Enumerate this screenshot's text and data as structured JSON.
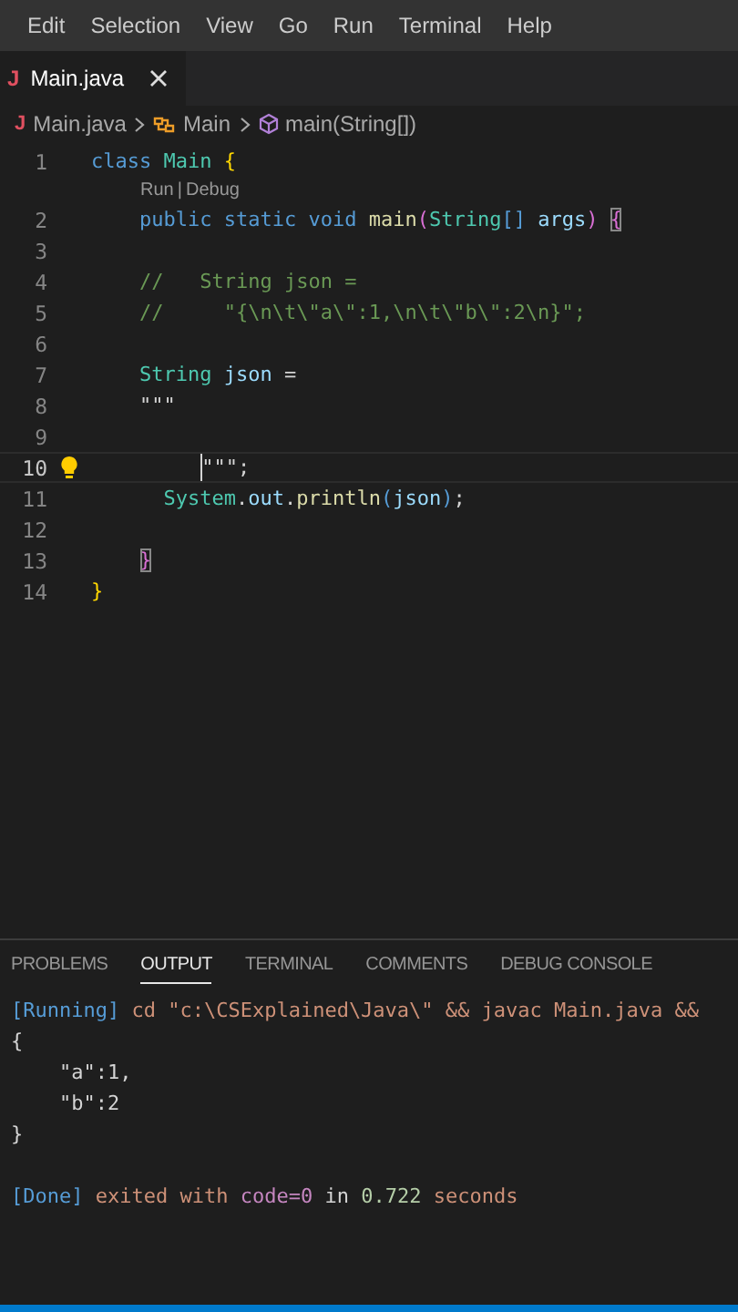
{
  "menu": [
    "Edit",
    "Selection",
    "View",
    "Go",
    "Run",
    "Terminal",
    "Help"
  ],
  "tabs": [
    {
      "label": "Main.java",
      "icon_text": "J",
      "selected": true,
      "closable": true
    }
  ],
  "breadcrumbs": [
    {
      "label": "Main.java",
      "kind": "file",
      "icon_text": "J"
    },
    {
      "label": "Main",
      "kind": "class"
    },
    {
      "label": "main(String[])",
      "kind": "method"
    }
  ],
  "editor": {
    "lines": [
      {
        "number": "1",
        "tokens": [
          {
            "text": "class ",
            "kind": "keyword"
          },
          {
            "text": "Main ",
            "kind": "type"
          },
          {
            "text": "{",
            "kind": "brace"
          }
        ],
        "codelens": {
          "items": [
            "Run",
            "Debug"
          ],
          "separator": "|"
        }
      },
      {
        "number": "2",
        "tokens": [
          {
            "text": "    public static void ",
            "kind": "keyword"
          },
          {
            "text": "main",
            "kind": "func"
          },
          {
            "text": "(",
            "kind": "paren"
          },
          {
            "text": "String",
            "kind": "type"
          },
          {
            "text": "[] ",
            "kind": "keyword"
          },
          {
            "text": "args",
            "kind": "var"
          },
          {
            "text": ") ",
            "kind": "paren"
          },
          {
            "text": "{",
            "kind": "matched"
          }
        ]
      },
      {
        "number": "3"
      },
      {
        "number": "4",
        "tokens": [
          {
            "text": "    //   String json =",
            "kind": "comment"
          }
        ]
      },
      {
        "number": "5",
        "tokens": [
          {
            "text": "    //     \"{\\n\\t\\\"a\\\":1,\\n\\t\\\"b\\\":2\\n}\";",
            "kind": "comment"
          }
        ]
      },
      {
        "number": "6"
      },
      {
        "number": "7",
        "tokens": [
          {
            "text": "    String ",
            "kind": "type"
          },
          {
            "text": "json ",
            "kind": "var"
          },
          {
            "text": "=",
            "kind": "plain"
          }
        ]
      },
      {
        "number": "8",
        "tokens": [
          {
            "text": "    \"\"\"",
            "kind": "plain"
          }
        ]
      },
      {
        "number": "9"
      },
      {
        "number": "10",
        "tokens": [
          {
            "text": "         \"\"\"",
            "kind": "plain"
          },
          {
            "text": ";",
            "kind": "plain"
          }
        ],
        "current": true,
        "lightbulb": true
      },
      {
        "number": "11",
        "tokens": [
          {
            "text": "      System",
            "kind": "type"
          },
          {
            "text": ".",
            "kind": "plain"
          },
          {
            "text": "out",
            "kind": "var"
          },
          {
            "text": ".",
            "kind": "plain"
          },
          {
            "text": "println",
            "kind": "func"
          },
          {
            "text": "(",
            "kind": "keyword"
          },
          {
            "text": "json",
            "kind": "var"
          },
          {
            "text": ")",
            "kind": "keyword"
          },
          {
            "text": ";",
            "kind": "plain"
          }
        ]
      },
      {
        "number": "12"
      },
      {
        "number": "13",
        "tokens": [
          {
            "text": "    }",
            "kind": "matched"
          }
        ]
      },
      {
        "number": "14",
        "tokens": [
          {
            "text": "}",
            "kind": "brace"
          }
        ]
      }
    ]
  },
  "panel": {
    "tabs": [
      {
        "label": "PROBLEMS",
        "selected": false
      },
      {
        "label": "OUTPUT",
        "selected": true
      },
      {
        "label": "TERMINAL",
        "selected": false
      },
      {
        "label": "COMMENTS",
        "selected": false
      },
      {
        "label": "DEBUG CONSOLE",
        "selected": false
      }
    ],
    "output": [
      [
        {
          "text": "[Running]",
          "kind": "tag"
        },
        {
          "text": " cd \"c:\\CSExplained\\Java\\\" && javac Main.java &&",
          "kind": "cmd"
        }
      ],
      [
        {
          "text": "{",
          "kind": "plain"
        }
      ],
      [
        {
          "text": "    \"a\":1,",
          "kind": "plain"
        }
      ],
      [
        {
          "text": "    \"b\":2",
          "kind": "plain"
        }
      ],
      [
        {
          "text": "}",
          "kind": "plain"
        }
      ],
      [
        {
          "text": "[Done]",
          "kind": "tag"
        },
        {
          "text": " exited with ",
          "kind": "cmd"
        },
        {
          "text": "code=0",
          "kind": "code"
        },
        {
          "text": " in ",
          "kind": "plain"
        },
        {
          "text": "0.722",
          "kind": "number"
        },
        {
          "text": " seconds",
          "kind": "cmd"
        }
      ]
    ]
  }
}
